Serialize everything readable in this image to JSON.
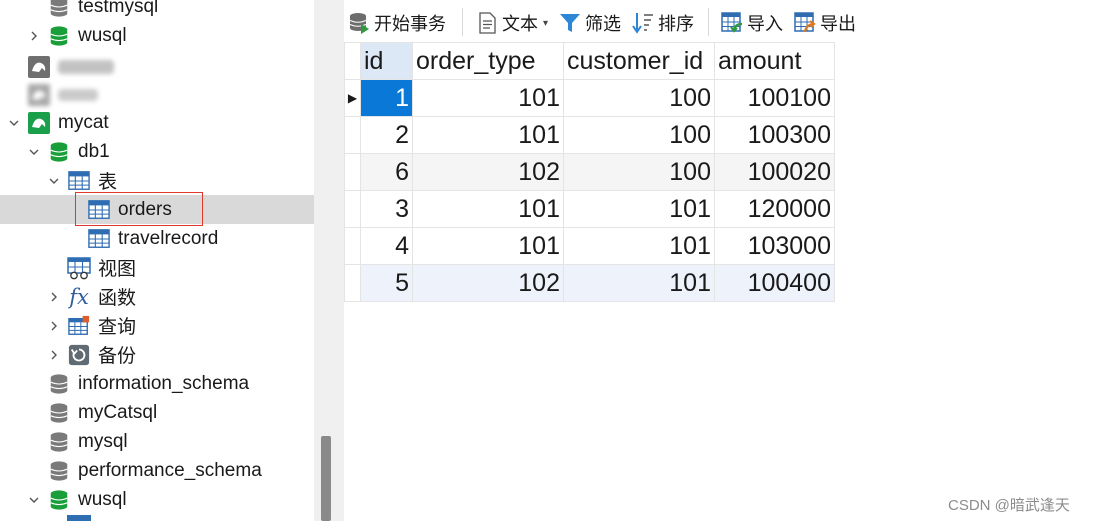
{
  "sidebar": {
    "items": [
      {
        "label": "testmysql",
        "icon": "database-icon"
      },
      {
        "label": "wusql",
        "icon": "database-icon"
      },
      {
        "label": "",
        "icon": "mysql-connection-icon"
      },
      {
        "label": "",
        "icon": "mysql-connection-icon"
      },
      {
        "label": "mycat",
        "icon": "mysql-connection-icon"
      },
      {
        "label": "db1",
        "icon": "database-icon"
      },
      {
        "label": "表",
        "icon": "table-folder-icon"
      },
      {
        "label": "orders",
        "icon": "table-icon"
      },
      {
        "label": "travelrecord",
        "icon": "table-icon"
      },
      {
        "label": "视图",
        "icon": "view-icon"
      },
      {
        "label": "函数",
        "icon": "function-icon"
      },
      {
        "label": "查询",
        "icon": "query-icon"
      },
      {
        "label": "备份",
        "icon": "backup-icon"
      },
      {
        "label": "information_schema",
        "icon": "database-icon"
      },
      {
        "label": "myCatsql",
        "icon": "database-icon"
      },
      {
        "label": "mysql",
        "icon": "database-icon"
      },
      {
        "label": "performance_schema",
        "icon": "database-icon"
      },
      {
        "label": "wusql",
        "icon": "database-icon"
      }
    ]
  },
  "toolbar": {
    "begin_transaction": "开始事务",
    "text": "文本",
    "filter": "筛选",
    "sort": "排序",
    "import": "导入",
    "export": "导出"
  },
  "grid": {
    "columns": [
      "id",
      "order_type",
      "customer_id",
      "amount"
    ],
    "rows": [
      [
        "1",
        "101",
        "100",
        "100100"
      ],
      [
        "2",
        "101",
        "100",
        "100300"
      ],
      [
        "6",
        "102",
        "100",
        "100020"
      ],
      [
        "3",
        "101",
        "101",
        "120000"
      ],
      [
        "4",
        "101",
        "101",
        "103000"
      ],
      [
        "5",
        "102",
        "101",
        "100400"
      ]
    ]
  },
  "watermark": "CSDN @暗武逢天",
  "colors": {
    "selection": "#0a78d7",
    "selected_row_bg": "#d9d9d9",
    "highlight_border": "#e0392b",
    "db_icon_green": "#1a9e3a"
  }
}
